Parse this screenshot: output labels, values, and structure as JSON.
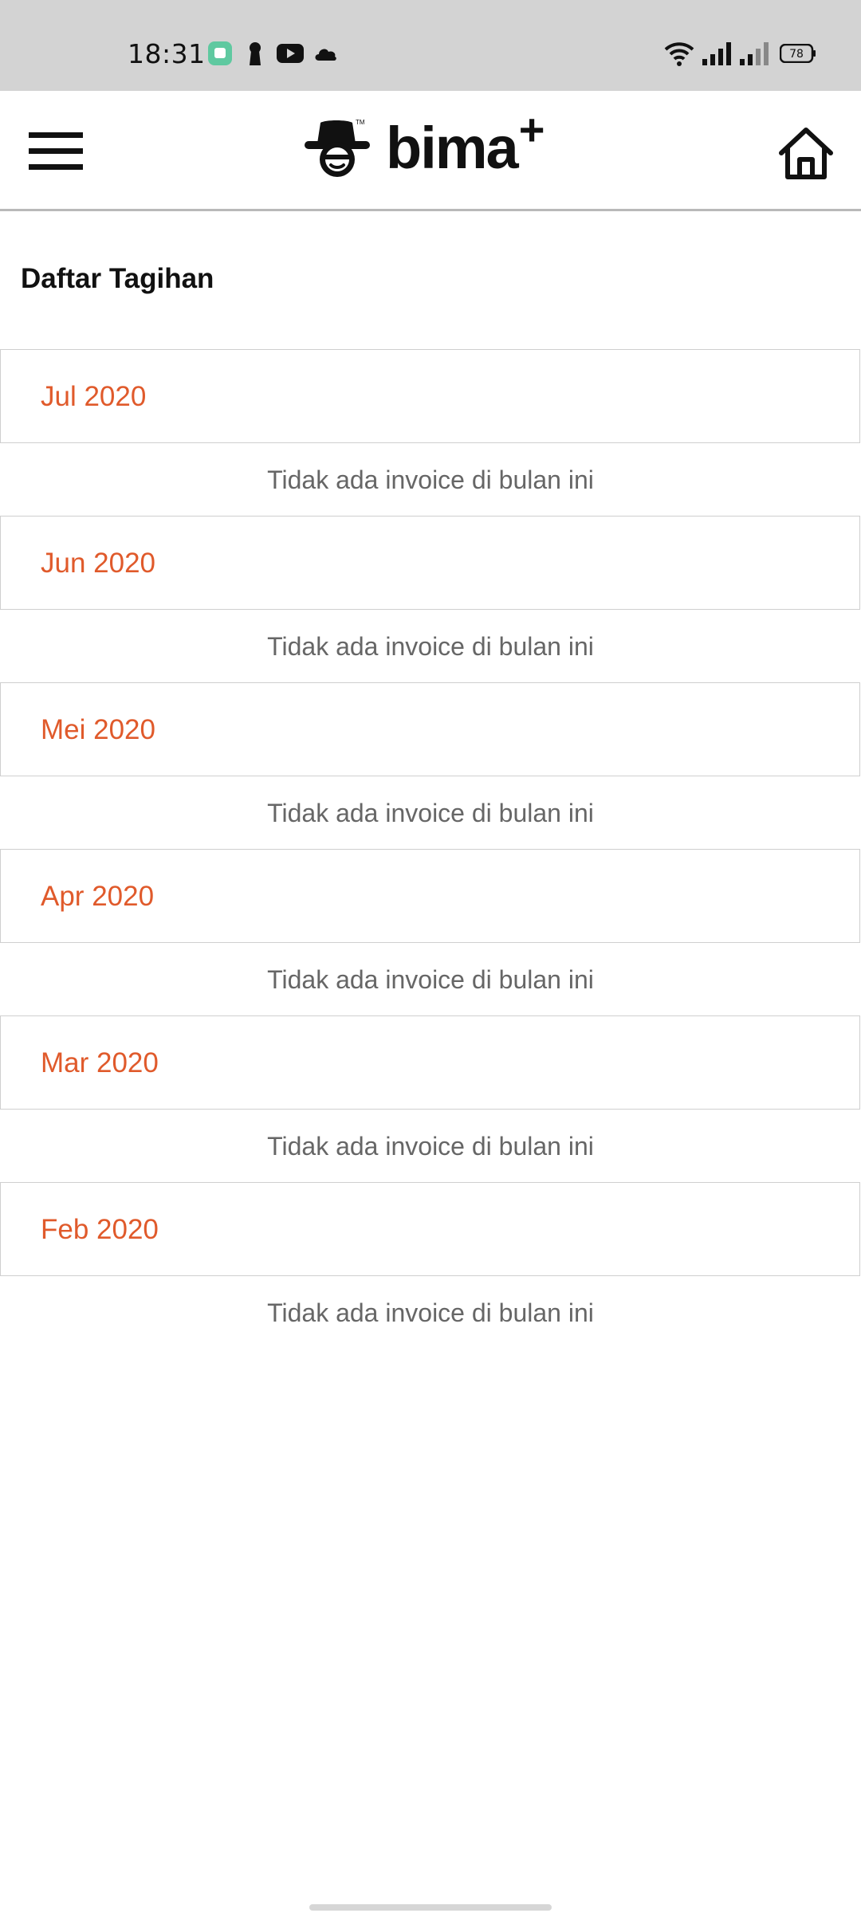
{
  "status_bar": {
    "time": "18:31",
    "battery_level": "78",
    "app_icons": [
      "chat-app-icon",
      "keyhole-icon",
      "youtube-icon",
      "cloud-icon"
    ],
    "right_icons": [
      "wifi-icon",
      "signal-icon",
      "signal-weak-icon",
      "battery-icon"
    ]
  },
  "header": {
    "logo_text": "bima",
    "logo_plus": "+",
    "logo_tm": "TM",
    "menu_icon": "hamburger-menu-icon",
    "home_icon": "home-icon"
  },
  "page": {
    "title": "Daftar Tagihan"
  },
  "months": [
    {
      "label": "Jul 2020",
      "empty_text": "Tidak ada invoice di bulan ini"
    },
    {
      "label": "Jun 2020",
      "empty_text": "Tidak ada invoice di bulan ini"
    },
    {
      "label": "Mei 2020",
      "empty_text": "Tidak ada invoice di bulan ini"
    },
    {
      "label": "Apr 2020",
      "empty_text": "Tidak ada invoice di bulan ini"
    },
    {
      "label": "Mar 2020",
      "empty_text": "Tidak ada invoice di bulan ini"
    },
    {
      "label": "Feb 2020",
      "empty_text": "Tidak ada invoice di bulan ini"
    }
  ],
  "colors": {
    "accent": "#e05a2b",
    "status_bar_bg": "#d3d3d3",
    "muted_text": "#666666",
    "border": "#cfcfcf"
  }
}
